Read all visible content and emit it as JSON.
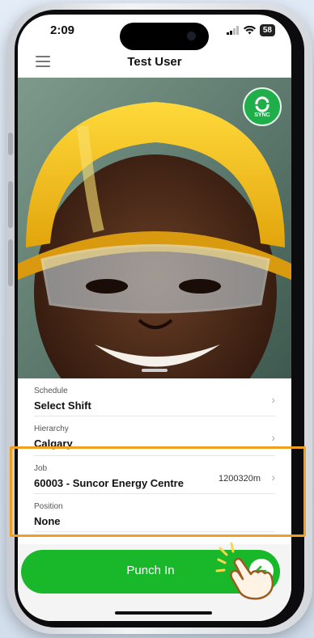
{
  "status_bar": {
    "time": "2:09",
    "battery": "58"
  },
  "header": {
    "title": "Test User"
  },
  "sync": {
    "label": "SYNC"
  },
  "fields": {
    "schedule": {
      "label": "Schedule",
      "value": "Select Shift"
    },
    "hierarchy": {
      "label": "Hierarchy",
      "value": "Calgary"
    },
    "job": {
      "label": "Job",
      "value": "60003 - Suncor Energy Centre",
      "distance": "1200320m"
    },
    "position": {
      "label": "Position",
      "value": "None"
    }
  },
  "punch": {
    "label": "Punch In"
  },
  "colors": {
    "accent_green": "#19b82b",
    "highlight": "#f0a020",
    "helmet": "#f5c11a"
  }
}
